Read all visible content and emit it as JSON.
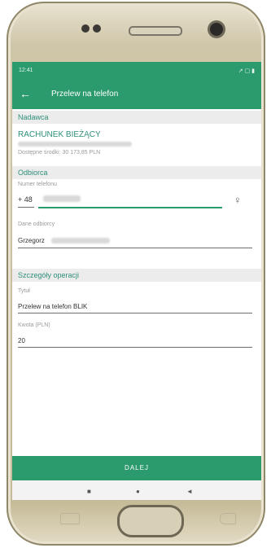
{
  "status": {
    "time": "12:41",
    "icons": "↗ ▢ ▮"
  },
  "appbar": {
    "back": "←",
    "title": "Przelew na telefon"
  },
  "sender": {
    "header": "Nadawca",
    "account_name": "RACHUNEK BIEŻĄCY",
    "available": "Dostępne środki: 30 173,85 PLN"
  },
  "recipient": {
    "header": "Odbiorca",
    "phone_label": "Numer telefonu",
    "phone_prefix": "+ 48",
    "contacts_icon": "♀",
    "name_label": "Dane odbiorcy",
    "name_value": "Grzegorz"
  },
  "details": {
    "header": "Szczegóły operacji",
    "title_label": "Tytuł",
    "title_value": "Przelew na telefon BLIK",
    "amount_label": "Kwota (PLN)",
    "amount_value": "20"
  },
  "actions": {
    "next": "DALEJ"
  },
  "navbar": {
    "recent": "■",
    "home": "●",
    "back": "◄"
  }
}
